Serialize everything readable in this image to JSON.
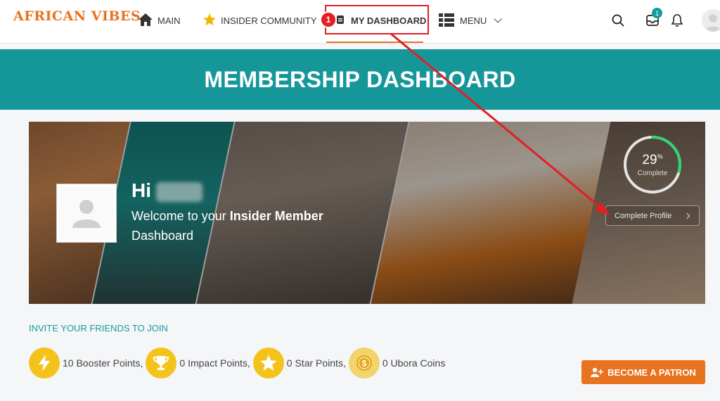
{
  "header": {
    "logo": "AFRICAN VIBES",
    "nav": {
      "main": "MAIN",
      "insider": "INSIDER COMMUNITY",
      "dashboard": "MY DASHBOARD",
      "menu": "MENU"
    },
    "step_badge": "1",
    "inbox_count": "1"
  },
  "banner": {
    "title": "MEMBERSHIP DASHBOARD"
  },
  "hero": {
    "greeting": "Hi",
    "welcome_prefix": "Welcome to your ",
    "welcome_bold": "Insider Member",
    "welcome_suffix": "Dashboard",
    "progress": {
      "value": "29",
      "unit": "%",
      "label": "Complete",
      "fraction": 0.29
    },
    "complete_profile": "Complete Profile"
  },
  "invite": "INVITE YOUR FRIENDS TO JOIN",
  "points": [
    {
      "text": "10 Booster Points,",
      "icon": "lightning-icon"
    },
    {
      "text": "0 Impact Points,",
      "icon": "trophy-icon"
    },
    {
      "text": "0 Star Points,",
      "icon": "star-icon"
    },
    {
      "text": "0 Ubora Coins",
      "icon": "coin-icon"
    }
  ],
  "patron_button": "BECOME A PATRON",
  "colors": {
    "accent": "#e8731f",
    "teal": "#15979a",
    "highlight": "#e31e24",
    "badge": "#f3c31c"
  }
}
